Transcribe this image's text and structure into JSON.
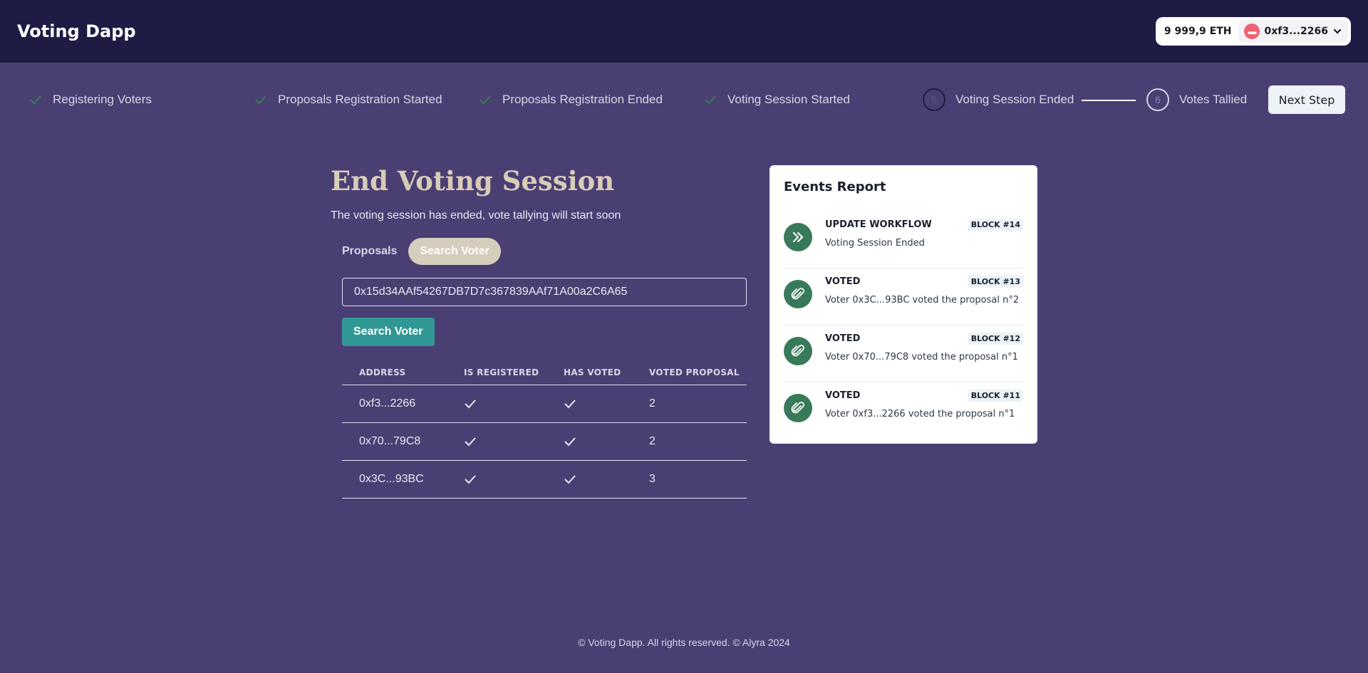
{
  "header": {
    "brand": "Voting Dapp",
    "balance": "9 999,9 ETH",
    "account": "0xf3...2266"
  },
  "stepper": {
    "steps": [
      {
        "label": "Registering Voters",
        "state": "done"
      },
      {
        "label": "Proposals Registration Started",
        "state": "done"
      },
      {
        "label": "Proposals Registration Ended",
        "state": "done"
      },
      {
        "label": "Voting Session Started",
        "state": "done"
      },
      {
        "label": "Voting Session Ended",
        "state": "current",
        "number": "5"
      },
      {
        "label": "Votes Tallied",
        "state": "pending",
        "number": "6"
      }
    ],
    "next_label": "Next Step"
  },
  "main": {
    "title": "End Voting Session",
    "subtitle": "The voting session has ended, vote tallying will start soon",
    "tabs": [
      {
        "label": "Proposals",
        "active": false
      },
      {
        "label": "Search Voter",
        "active": true
      }
    ],
    "search_value": "0x15d34AAf54267DB7D7c367839AAf71A00a2C6A65",
    "search_button": "Search Voter",
    "table": {
      "headers": [
        "ADDRESS",
        "IS REGISTERED",
        "HAS VOTED",
        "VOTED PROPOSAL"
      ],
      "rows": [
        {
          "address": "0xf3...2266",
          "registered": true,
          "voted": true,
          "proposal": "2"
        },
        {
          "address": "0x70...79C8",
          "registered": true,
          "voted": true,
          "proposal": "2"
        },
        {
          "address": "0x3C...93BC",
          "registered": true,
          "voted": true,
          "proposal": "3"
        }
      ]
    }
  },
  "events": {
    "title": "Events Report",
    "items": [
      {
        "type": "UPDATE WORKFLOW",
        "block": "BLOCK #14",
        "desc": "Voting Session Ended",
        "icon": "chevrons-right-icon"
      },
      {
        "type": "VOTED",
        "block": "BLOCK #13",
        "desc": "Voter 0x3C...93BC voted the proposal n°2",
        "icon": "paperclip-icon"
      },
      {
        "type": "VOTED",
        "block": "BLOCK #12",
        "desc": "Voter 0x70...79C8 voted the proposal n°1",
        "icon": "paperclip-icon"
      },
      {
        "type": "VOTED",
        "block": "BLOCK #11",
        "desc": "Voter 0xf3...2266 voted the proposal n°1",
        "icon": "paperclip-icon"
      }
    ]
  },
  "footer": "© Voting Dapp. All rights reserved. © Alyra 2024",
  "colors": {
    "background": "#4a3f73",
    "header": "#1e1c45",
    "accent_teal": "#319795",
    "check_green": "#38795a",
    "title": "#d8cbb7"
  }
}
